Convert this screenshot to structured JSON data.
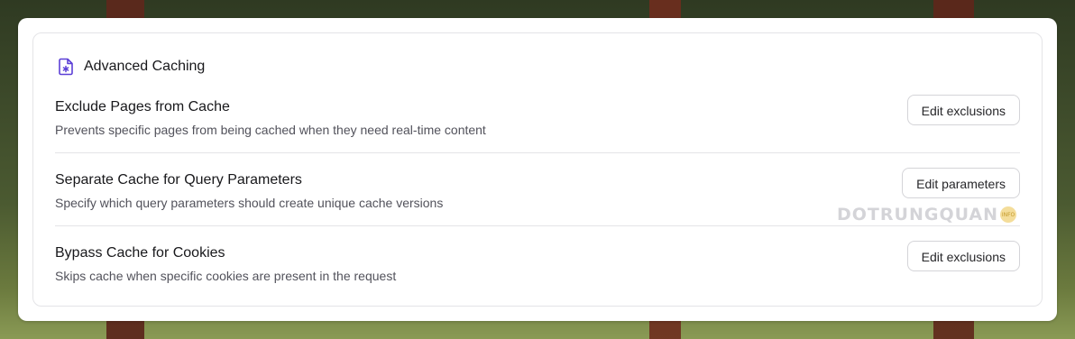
{
  "panel": {
    "title": "Advanced Caching",
    "icon": "file-asterisk-icon",
    "accent_color": "#5b3fd6"
  },
  "rows": [
    {
      "title": "Exclude Pages from Cache",
      "description": "Prevents specific pages from being cached when they need real-time content",
      "button_label": "Edit exclusions"
    },
    {
      "title": "Separate Cache for Query Parameters",
      "description": "Specify which query parameters should create unique cache versions",
      "button_label": "Edit parameters"
    },
    {
      "title": "Bypass Cache for Cookies",
      "description": "Skips cache when specific cookies are present in the request",
      "button_label": "Edit exclusions"
    }
  ],
  "watermark": {
    "text": "DOTRUNGQUAN",
    "badge": "INFO"
  }
}
